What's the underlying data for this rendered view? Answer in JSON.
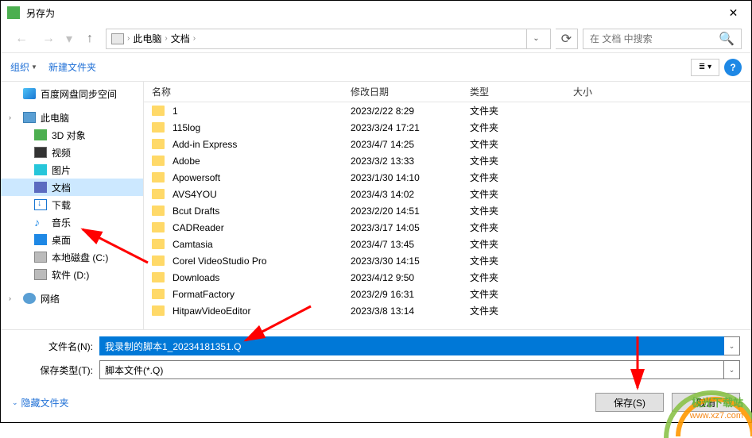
{
  "window": {
    "title": "另存为",
    "close": "✕"
  },
  "nav": {
    "back": "←",
    "forward": "→",
    "up": "↑",
    "breadcrumb": {
      "root": "此电脑",
      "folder": "文档"
    },
    "search_placeholder": "在 文档 中搜索"
  },
  "toolbar": {
    "organize": "组织",
    "new_folder": "新建文件夹"
  },
  "sidebar": {
    "items": [
      {
        "label": "百度网盘同步空间",
        "icon": "ic-baidu"
      },
      {
        "label": "此电脑",
        "icon": "ic-pc",
        "chev": true
      },
      {
        "label": "3D 对象",
        "icon": "ic-3d",
        "indent": 1
      },
      {
        "label": "视频",
        "icon": "ic-video",
        "indent": 1
      },
      {
        "label": "图片",
        "icon": "ic-pic",
        "indent": 1
      },
      {
        "label": "文档",
        "icon": "ic-doc",
        "indent": 1,
        "selected": true
      },
      {
        "label": "下载",
        "icon": "ic-dl",
        "indent": 1
      },
      {
        "label": "音乐",
        "icon": "ic-music",
        "indent": 1,
        "glyph": "♪"
      },
      {
        "label": "桌面",
        "icon": "ic-desktop",
        "indent": 1
      },
      {
        "label": "本地磁盘 (C:)",
        "icon": "ic-disk",
        "indent": 1
      },
      {
        "label": "软件 (D:)",
        "icon": "ic-disk",
        "indent": 1
      },
      {
        "label": "网络",
        "icon": "ic-net",
        "chev": true
      }
    ]
  },
  "filelist": {
    "headers": {
      "name": "名称",
      "date": "修改日期",
      "type": "类型",
      "size": "大小"
    },
    "type_folder": "文件夹",
    "rows": [
      {
        "name": "1",
        "date": "2023/2/22 8:29"
      },
      {
        "name": "115log",
        "date": "2023/3/24 17:21"
      },
      {
        "name": "Add-in Express",
        "date": "2023/4/7 14:25"
      },
      {
        "name": "Adobe",
        "date": "2023/3/2 13:33"
      },
      {
        "name": "Apowersoft",
        "date": "2023/1/30 14:10"
      },
      {
        "name": "AVS4YOU",
        "date": "2023/4/3 14:02"
      },
      {
        "name": "Bcut Drafts",
        "date": "2023/2/20 14:51"
      },
      {
        "name": "CADReader",
        "date": "2023/3/17 14:05"
      },
      {
        "name": "Camtasia",
        "date": "2023/4/7 13:45"
      },
      {
        "name": "Corel VideoStudio Pro",
        "date": "2023/3/30 14:15"
      },
      {
        "name": "Downloads",
        "date": "2023/4/12 9:50"
      },
      {
        "name": "FormatFactory",
        "date": "2023/2/9 16:31"
      },
      {
        "name": "HitpawVideoEditor",
        "date": "2023/3/8 13:14"
      }
    ]
  },
  "form": {
    "filename_label": "文件名(N):",
    "filename_value": "我录制的脚本1_20234181351.Q",
    "type_label": "保存类型(T):",
    "type_value": "脚本文件(*.Q)"
  },
  "footer": {
    "hide_folders": "隐藏文件夹",
    "save": "保存(S)",
    "cancel": "取消"
  },
  "watermark": {
    "site": "极光下载站",
    "url": "www.xz7.com"
  }
}
